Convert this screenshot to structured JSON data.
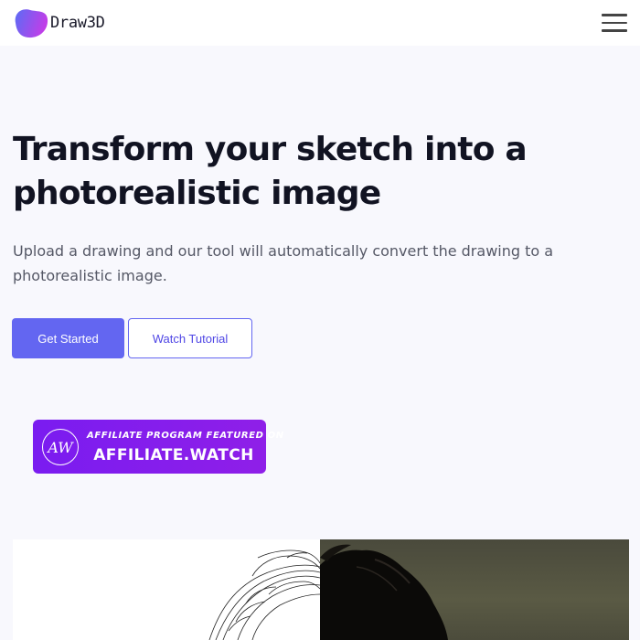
{
  "brand": {
    "name": "Draw3D",
    "logo_colors": [
      "#5b6cf5",
      "#c13ee8"
    ]
  },
  "nav": {
    "menu_icon": "hamburger-menu-icon"
  },
  "hero": {
    "title": "Transform your sketch into a photorealistic image",
    "subtitle": "Upload a drawing and our tool will automatically convert the drawing to a photorealistic image.",
    "primary_button": "Get Started",
    "secondary_button": "Watch Tutorial"
  },
  "affiliate_badge": {
    "logo_text": "AW",
    "line1": "AFFILIATE PROGRAM FEATURED ON",
    "line2": "AFFILIATE.WATCH",
    "color": "#8a1ee8"
  },
  "preview": {
    "left_icon": "sketch-drawing-image",
    "right_icon": "photorealistic-photo-image"
  },
  "colors": {
    "accent": "#6366f1",
    "background": "#f8f8fd",
    "title": "#111322"
  }
}
